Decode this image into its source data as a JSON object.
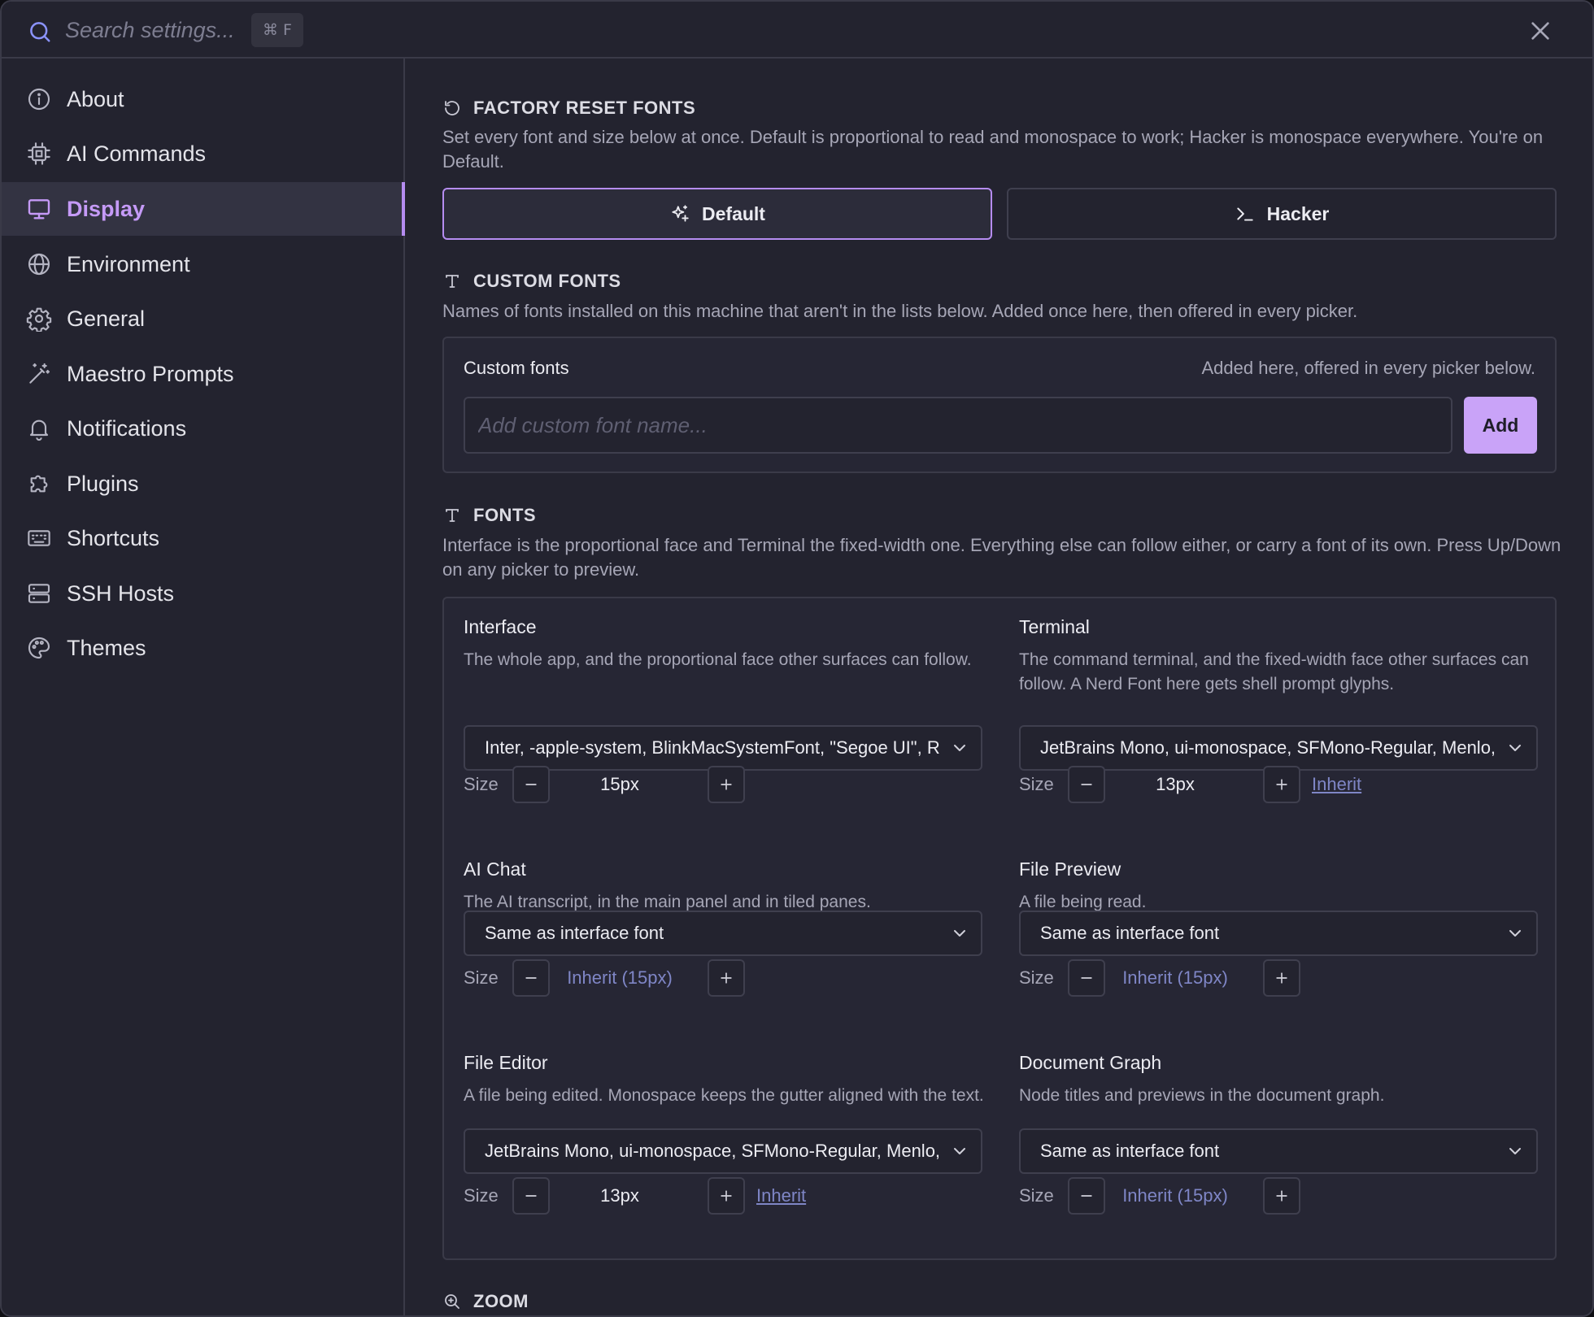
{
  "search": {
    "placeholder": "Search settings...",
    "shortcut": "⌘ F"
  },
  "sidebar": {
    "items": [
      {
        "label": "About",
        "icon": "info-icon"
      },
      {
        "label": "AI Commands",
        "icon": "cpu-icon"
      },
      {
        "label": "Display",
        "icon": "monitor-icon",
        "active": true
      },
      {
        "label": "Environment",
        "icon": "globe-icon"
      },
      {
        "label": "General",
        "icon": "gear-icon"
      },
      {
        "label": "Maestro Prompts",
        "icon": "wand-icon"
      },
      {
        "label": "Notifications",
        "icon": "bell-icon"
      },
      {
        "label": "Plugins",
        "icon": "puzzle-icon"
      },
      {
        "label": "Shortcuts",
        "icon": "keyboard-icon"
      },
      {
        "label": "SSH Hosts",
        "icon": "server-icon"
      },
      {
        "label": "Themes",
        "icon": "palette-icon"
      }
    ]
  },
  "factory_reset": {
    "title": "FACTORY RESET FONTS",
    "description": "Set every font and size below at once. Default is proportional to read and monospace to work; Hacker is monospace everywhere. You're on Default.",
    "default_label": "Default",
    "hacker_label": "Hacker"
  },
  "custom_fonts": {
    "title": "CUSTOM FONTS",
    "description": "Names of fonts installed on this machine that aren't in the lists below. Added once here, then offered in every picker.",
    "label": "Custom fonts",
    "hint": "Added here, offered in every picker below.",
    "placeholder": "Add custom font name...",
    "add_label": "Add"
  },
  "fonts": {
    "title": "FONTS",
    "description": "Interface is the proportional face and Terminal the fixed-width one. Everything else can follow either, or carry a font of its own. Press Up/Down on any picker to preview.",
    "size_label": "Size",
    "inherit_link": "Inherit",
    "interface": {
      "title": "Interface",
      "desc": "The whole app, and the proportional face other surfaces can follow.",
      "value": "Inter, -apple-system, BlinkMacSystemFont, \"Segoe UI\", Roboto, sans-serif",
      "size": "15px"
    },
    "terminal": {
      "title": "Terminal",
      "desc": "The command terminal, and the fixed-width face other surfaces can follow. A Nerd Font here gets shell prompt glyphs.",
      "value": "JetBrains Mono, ui-monospace, SFMono-Regular, Menlo, monospace",
      "size": "13px"
    },
    "ai_chat": {
      "title": "AI Chat",
      "desc": "The AI transcript, in the main panel and in tiled panes.",
      "value": "Same as interface font",
      "size": "Inherit (15px)"
    },
    "file_preview": {
      "title": "File Preview",
      "desc": "A file being read.",
      "value": "Same as interface font",
      "size": "Inherit (15px)"
    },
    "file_editor": {
      "title": "File Editor",
      "desc": "A file being edited. Monospace keeps the gutter aligned with the text.",
      "value": "JetBrains Mono, ui-monospace, SFMono-Regular, Menlo, monospace",
      "size": "13px"
    },
    "document_graph": {
      "title": "Document Graph",
      "desc": "Node titles and previews in the document graph.",
      "value": "Same as interface font",
      "size": "Inherit (15px)"
    }
  },
  "zoom": {
    "title": "ZOOM"
  },
  "colors": {
    "accent": "#c59af7",
    "background": "#23232f",
    "border": "#3a3a48",
    "link": "#7f86c6"
  }
}
